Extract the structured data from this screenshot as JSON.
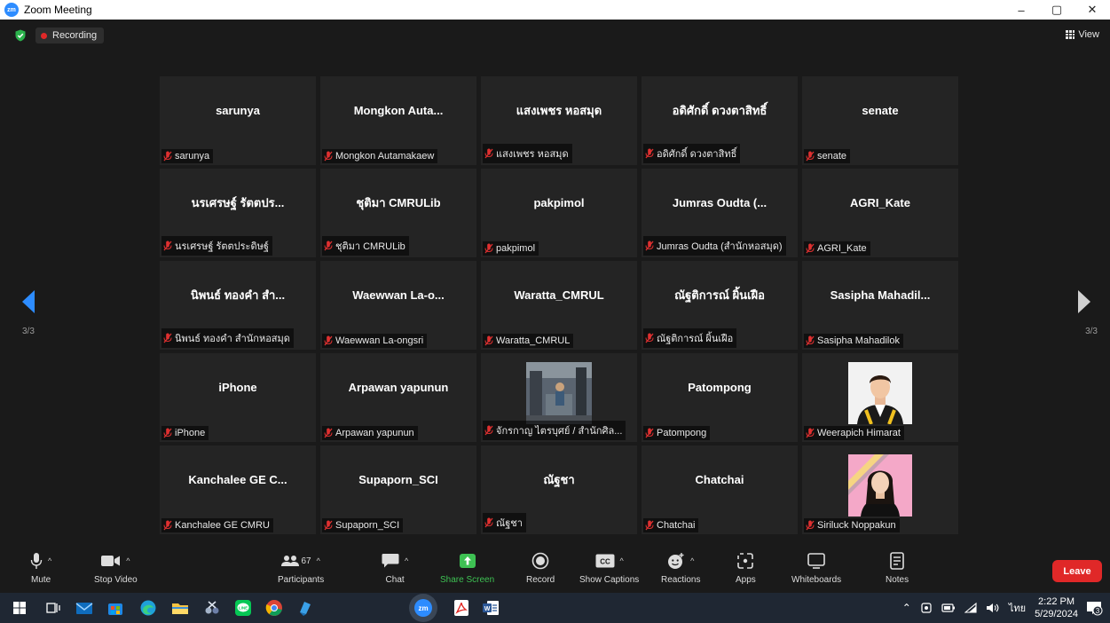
{
  "window": {
    "title": "Zoom Meeting",
    "minimize": "–",
    "restore": "▢",
    "close": "✕"
  },
  "meeting": {
    "recording_label": "Recording",
    "view_label": "View",
    "page_left": "3/3",
    "page_right": "3/3"
  },
  "participants": [
    {
      "display": "sarunya",
      "label": "sarunya"
    },
    {
      "display": "Mongkon  Auta...",
      "label": "Mongkon Autamakaew"
    },
    {
      "display": "แสงเพชร หอสมุด",
      "label": "แสงเพชร หอสมุด"
    },
    {
      "display": "อดิศักดิ์ ดวงตาสิทธิ์",
      "label": "อดิศักดิ์ ดวงตาสิทธิ์"
    },
    {
      "display": "senate",
      "label": "senate"
    },
    {
      "display": "นรเศรษฐ์ รัตตปร...",
      "label": "นรเศรษฐ์ รัตตประดิษฐ์"
    },
    {
      "display": "ชุติมา CMRULib",
      "label": "ชุติมา CMRULib"
    },
    {
      "display": "pakpimol",
      "label": "pakpimol"
    },
    {
      "display": "Jumras  Oudta  (...",
      "label": "Jumras Oudta (สำนักหอสมุด)"
    },
    {
      "display": "AGRI_Kate",
      "label": "AGRI_Kate"
    },
    {
      "display": "นิพนธ์  ทองคำ  สำ...",
      "label": "นิพนธ์ ทองคำ สำนักหอสมุด"
    },
    {
      "display": "Waewwan  La-o...",
      "label": "Waewwan La-ongsri"
    },
    {
      "display": "Waratta_CMRUL",
      "label": "Waratta_CMRUL"
    },
    {
      "display": "ณัฐติการณ์  ผิ้นเฝือ",
      "label": "ณัฐติการณ์ ผิ้นเฝือ"
    },
    {
      "display": "Sasipha  Mahadil...",
      "label": "Sasipha Mahadilok"
    },
    {
      "display": "iPhone",
      "label": "iPhone"
    },
    {
      "display": "Arpawan yapunun",
      "label": "Arpawan yapunun"
    },
    {
      "display": "",
      "label": "จักรกาญ ไตรบุศย์ / สำนักศิล...",
      "video": true
    },
    {
      "display": "Patompong",
      "label": "Patompong"
    },
    {
      "display": "",
      "label": "Weerapich Himarat",
      "photo": "man"
    },
    {
      "display": "Kanchalee  GE  C...",
      "label": "Kanchalee GE CMRU"
    },
    {
      "display": "Supaporn_SCI",
      "label": "Supaporn_SCI"
    },
    {
      "display": "ณัฐชา",
      "label": "ณัฐชา"
    },
    {
      "display": "Chatchai",
      "label": "Chatchai"
    },
    {
      "display": "",
      "label": "Siriluck Noppakun",
      "photo": "woman"
    }
  ],
  "toolbar": {
    "mute": "Mute",
    "stop_video": "Stop Video",
    "participants": "Participants",
    "participants_count": "67",
    "chat": "Chat",
    "share_screen": "Share Screen",
    "record": "Record",
    "show_captions": "Show Captions",
    "reactions": "Reactions",
    "apps": "Apps",
    "whiteboards": "Whiteboards",
    "notes": "Notes",
    "leave": "Leave",
    "accent_green": "#3ec153",
    "leave_color": "#e02828"
  },
  "taskbar": {
    "time": "2:22 PM",
    "date": "5/29/2024",
    "lang": "ไทย",
    "zoom_label": "zm",
    "notif_count": "3"
  }
}
